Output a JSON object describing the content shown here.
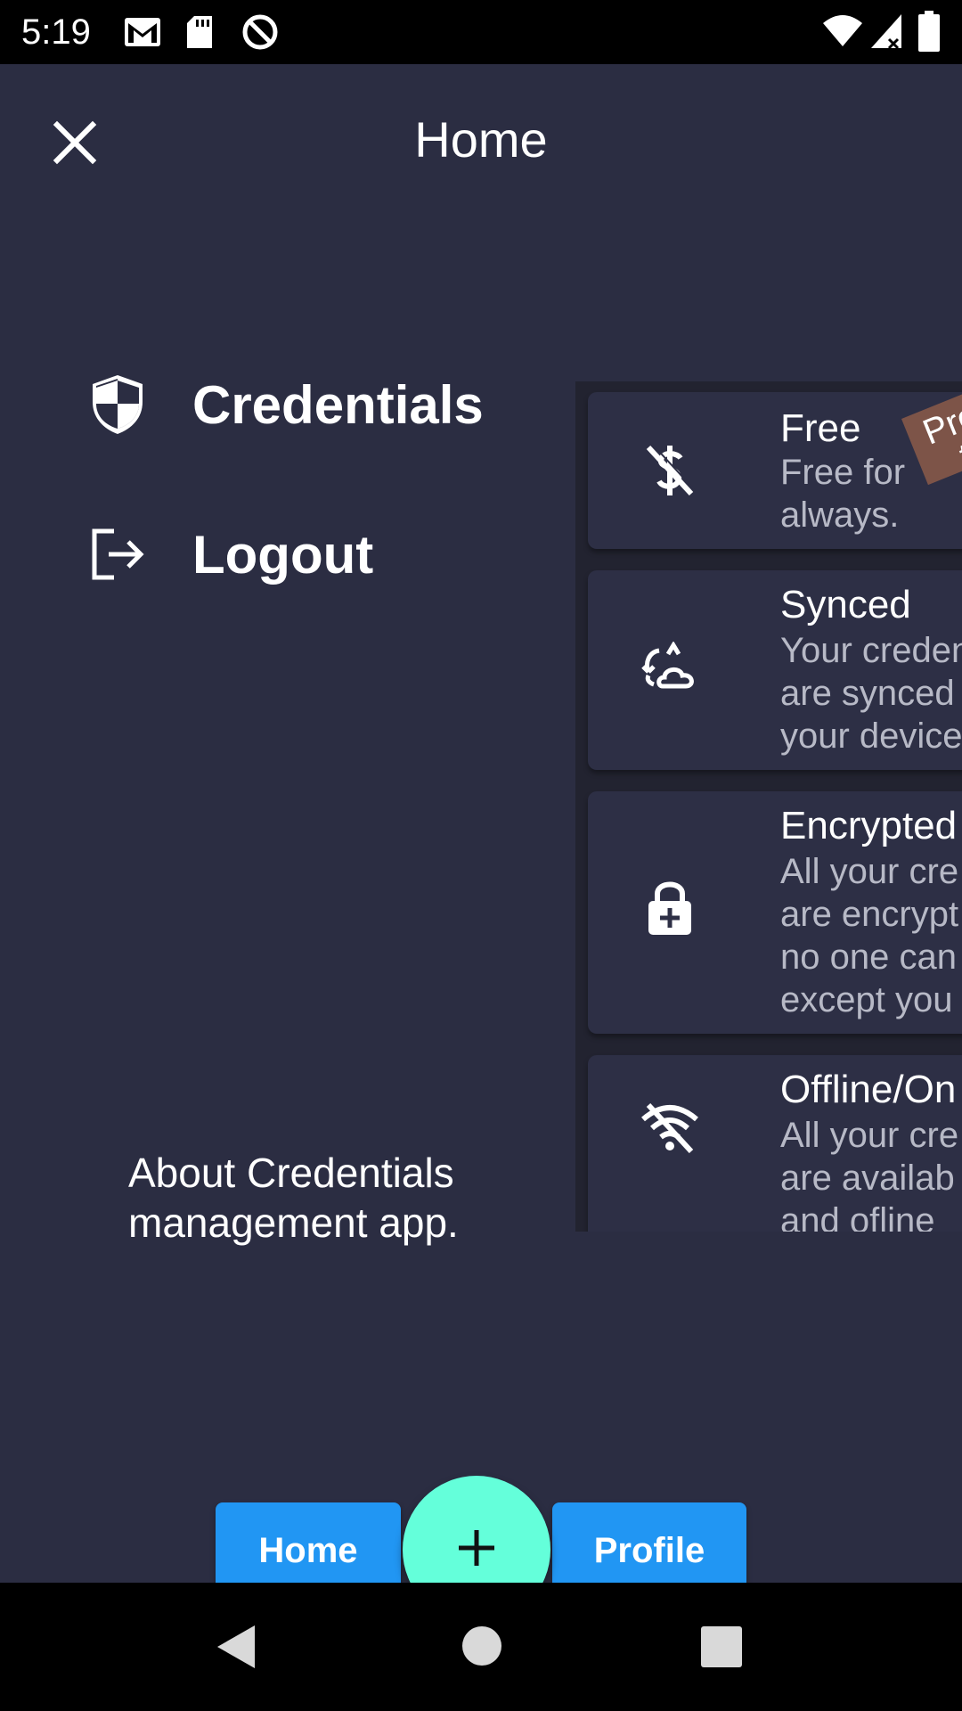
{
  "status_bar": {
    "time": "5:19",
    "icons": [
      "gmail-icon",
      "sd-card-icon",
      "sync-blocked-icon",
      "wifi-icon",
      "signal-icon",
      "battery-icon"
    ]
  },
  "header": {
    "title": "Home",
    "close_icon": "close-icon"
  },
  "menu": {
    "items": [
      {
        "label": "Credentials",
        "icon": "shield-icon"
      },
      {
        "label": "Logout",
        "icon": "logout-icon"
      }
    ]
  },
  "about": {
    "line1": "About Credentials",
    "line2": "management app."
  },
  "features": [
    {
      "title": "Free",
      "lines": [
        "Free for",
        "always."
      ],
      "icon": "dollar-off-icon",
      "ribbon": [
        "Pro",
        "th"
      ]
    },
    {
      "title": "Synced",
      "lines": [
        "Your creden",
        "are synced",
        "your device"
      ],
      "icon": "cloud-sync-icon"
    },
    {
      "title": "Encrypted",
      "lines": [
        "All your cre",
        "are encrypt",
        "no one can",
        "except you"
      ],
      "icon": "lock-plus-icon"
    },
    {
      "title": "Offline/On",
      "lines": [
        "All your cre",
        "are availab",
        "and ofline"
      ],
      "icon": "wifi-off-icon"
    }
  ],
  "bottom_nav": {
    "home_label": "Home",
    "profile_label": "Profile",
    "fab_icon": "plus-icon"
  },
  "system_nav": [
    "back-icon",
    "home-circle-icon",
    "recents-icon"
  ],
  "colors": {
    "background": "#2b2d42",
    "card": "#2d2f45",
    "accent_blue": "#2196f3",
    "fab": "#64ffda",
    "ribbon": "#7d5448"
  }
}
